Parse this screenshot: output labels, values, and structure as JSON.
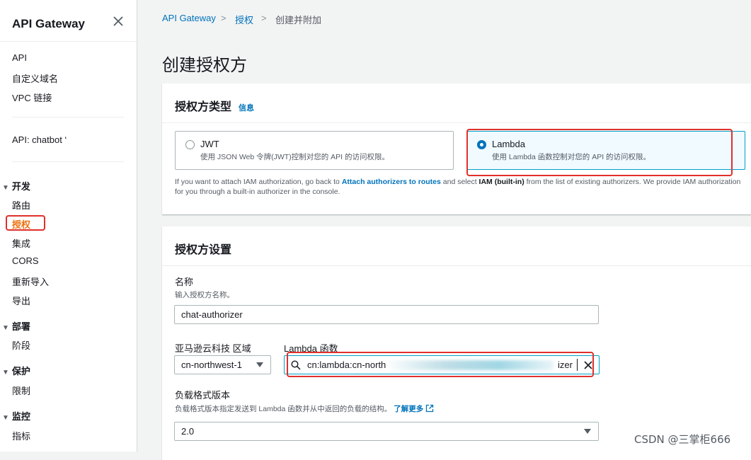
{
  "sidebar": {
    "title": "API Gateway",
    "top_items": [
      "API",
      "自定义域名",
      "VPC 链接"
    ],
    "api_label": "API: chatbot ‘",
    "sections": [
      {
        "label": "开发",
        "items": [
          "路由",
          "授权",
          "集成",
          "CORS",
          "重新导入",
          "导出"
        ]
      },
      {
        "label": "部署",
        "items": [
          "阶段"
        ]
      },
      {
        "label": "保护",
        "items": [
          "限制"
        ]
      },
      {
        "label": "监控",
        "items": [
          "指标"
        ]
      }
    ],
    "active_item": "授权"
  },
  "breadcrumb": {
    "items": [
      "API Gateway",
      "授权",
      "创建并附加"
    ]
  },
  "page_title": "创建授权方",
  "authorizer_type": {
    "heading": "授权方类型",
    "info": "信息",
    "options": [
      {
        "title": "JWT",
        "desc": "使用 JSON Web 令牌(JWT)控制对您的 API 的访问权限。",
        "selected": false
      },
      {
        "title": "Lambda",
        "desc": "使用 Lambda 函数控制对您的 API 的访问权限。",
        "selected": true
      }
    ],
    "note_pre": "If you want to attach IAM authorization, go back to ",
    "note_link": "Attach authorizers to routes",
    "note_mid": " and select ",
    "note_bold": "IAM (built-in)",
    "note_post": " from the list of existing authorizers. We provide IAM authorization for you through a built-in authorizer in the console."
  },
  "settings": {
    "heading": "授权方设置",
    "name_label": "名称",
    "name_hint": "输入授权方名称。",
    "name_value": "chat-authorizer",
    "region_label": "亚马逊云科技 区域",
    "region_value": "cn-northwest-1",
    "lambda_label": "Lambda 函数",
    "lambda_value_start": "cn:lambda:cn-north",
    "lambda_value_end": "izer",
    "payload_label": "负载格式版本",
    "payload_hint": "负载格式版本指定发送到 Lambda 函数并从中返回的负载的结构。",
    "payload_link": "了解更多",
    "payload_value": "2.0"
  },
  "watermark": "CSDN @三掌柜666",
  "colors": {
    "accent": "#0073bb",
    "active": "#ec7211",
    "highlight": "#e0302b"
  }
}
